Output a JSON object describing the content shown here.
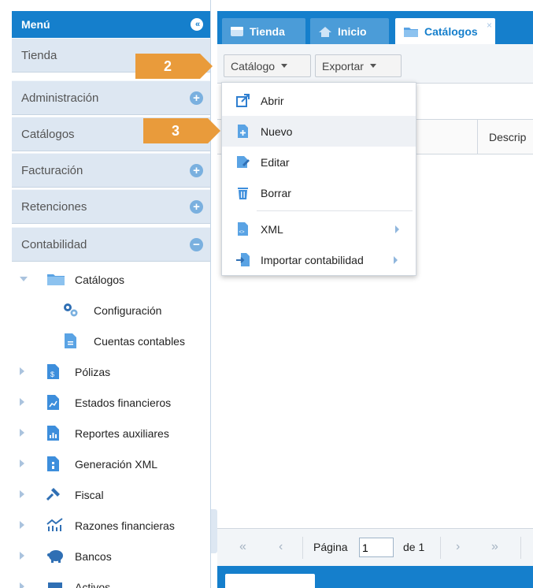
{
  "sidebar": {
    "title": "Menú",
    "collapse_glyph": "«",
    "sections": [
      {
        "label": "Tienda",
        "toggle": ""
      },
      {
        "label": "Administración",
        "toggle": "+"
      },
      {
        "label": "Catálogos",
        "toggle": ""
      },
      {
        "label": "Facturación",
        "toggle": "+"
      },
      {
        "label": "Retenciones",
        "toggle": "+"
      },
      {
        "label": "Contabilidad",
        "toggle": "−"
      }
    ],
    "tree": [
      {
        "label": "Catálogos",
        "icon": "folder-icon"
      },
      {
        "label": "Configuración",
        "icon": "gears-icon"
      },
      {
        "label": "Cuentas contables",
        "icon": "document-icon"
      },
      {
        "label": "Pólizas",
        "icon": "policy-document-icon"
      },
      {
        "label": "Estados financieros",
        "icon": "chart-document-icon"
      },
      {
        "label": "Reportes auxiliares",
        "icon": "bar-report-icon"
      },
      {
        "label": "Generación XML",
        "icon": "xml-document-icon"
      },
      {
        "label": "Fiscal",
        "icon": "gavel-icon"
      },
      {
        "label": "Razones financieras",
        "icon": "ratios-chart-icon"
      },
      {
        "label": "Bancos",
        "icon": "piggy-bank-icon"
      },
      {
        "label": "Activos",
        "icon": "assets-icon"
      }
    ]
  },
  "tabs": [
    {
      "label": "Tienda",
      "icon": "store-icon"
    },
    {
      "label": "Inicio",
      "icon": "home-icon"
    },
    {
      "label": "Catálogos",
      "icon": "folder-icon",
      "close": "×"
    }
  ],
  "toolbar": {
    "catalog_label": "Catálogo",
    "export_label": "Exportar"
  },
  "dropdown": {
    "items": [
      {
        "label": "Abrir",
        "icon": "open-external-icon"
      },
      {
        "label": "Nuevo",
        "icon": "new-document-icon"
      },
      {
        "label": "Editar",
        "icon": "edit-icon"
      },
      {
        "label": "Borrar",
        "icon": "trash-icon"
      },
      {
        "label": "XML",
        "icon": "xml-file-icon"
      },
      {
        "label": "Importar contabilidad",
        "icon": "import-icon"
      }
    ]
  },
  "grid": {
    "column_description": "Descrip"
  },
  "pager": {
    "first": "«",
    "prev": "‹",
    "page_label": "Página",
    "page_value": "1",
    "of_label": "de 1",
    "next": "›",
    "last": "»"
  },
  "callouts": [
    "2",
    "3"
  ],
  "colors": {
    "accent": "#157fcc",
    "callout": "#e99b3b",
    "section_bg": "#dde7f2"
  }
}
